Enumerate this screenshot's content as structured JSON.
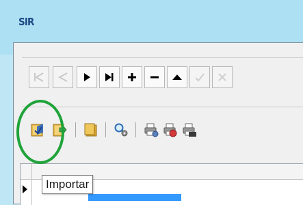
{
  "window": {
    "app_logo_text": "SIR"
  },
  "nav_buttons": [
    {
      "name": "first-record-button",
      "icon": "first-icon",
      "enabled": false
    },
    {
      "name": "prior-record-button",
      "icon": "prior-icon",
      "enabled": false
    },
    {
      "name": "next-record-button",
      "icon": "next-icon",
      "enabled": true
    },
    {
      "name": "last-record-button",
      "icon": "last-icon",
      "enabled": true
    },
    {
      "name": "insert-record-button",
      "icon": "plus-icon",
      "enabled": true
    },
    {
      "name": "delete-record-button",
      "icon": "minus-icon",
      "enabled": true
    },
    {
      "name": "edit-record-button",
      "icon": "up-triangle-icon",
      "enabled": true
    },
    {
      "name": "post-record-button",
      "icon": "check-icon",
      "enabled": false
    },
    {
      "name": "cancel-record-button",
      "icon": "cancel-x-icon",
      "enabled": false
    }
  ],
  "toolbar": {
    "tooltip": "Importar",
    "buttons": [
      {
        "name": "import-button",
        "icon": "import-icon"
      },
      {
        "name": "export-button",
        "icon": "export-icon"
      },
      {
        "name": "folder-button",
        "icon": "folder-icon"
      },
      {
        "name": "search-settings-button",
        "icon": "magnifier-gear-icon"
      },
      {
        "name": "print-settings-button",
        "icon": "printer-gear-icon"
      },
      {
        "name": "print-pdf-button",
        "icon": "printer-pdf-icon"
      },
      {
        "name": "print-txt-button",
        "icon": "printer-txt-icon"
      }
    ]
  },
  "grid": {
    "selected_cell_text": ""
  },
  "colors": {
    "highlight": "#1fa33a",
    "selection": "#3399ff",
    "titlebar": "#aee0f4"
  }
}
